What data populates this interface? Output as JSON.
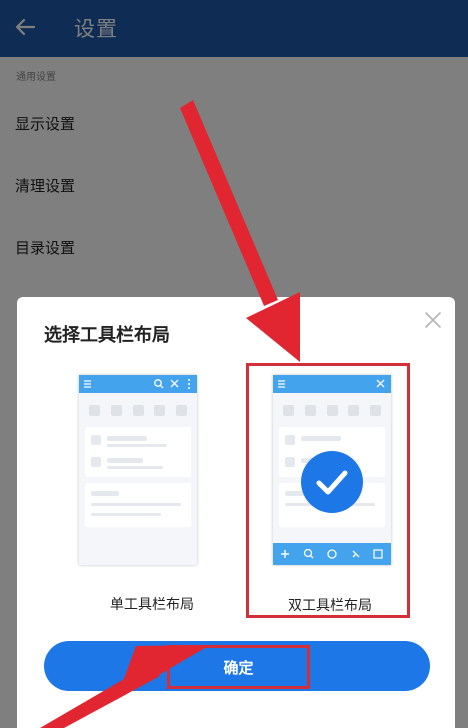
{
  "appbar": {
    "title": "设置",
    "back_icon": "arrow-left-icon"
  },
  "settings": {
    "section_label": "通用设置",
    "items": [
      "显示设置",
      "清理设置",
      "目录设置"
    ]
  },
  "dialog": {
    "title": "选择工具栏布局",
    "close_icon": "close-icon",
    "options": [
      {
        "label": "单工具栏布局",
        "selected": false
      },
      {
        "label": "双工具栏布局",
        "selected": true
      }
    ],
    "confirm_label": "确定"
  },
  "colors": {
    "appbar": "#1f5aa8",
    "primary": "#1d77e6",
    "toolbar_preview": "#43a3ec",
    "annotation_red": "#d32f3a"
  }
}
